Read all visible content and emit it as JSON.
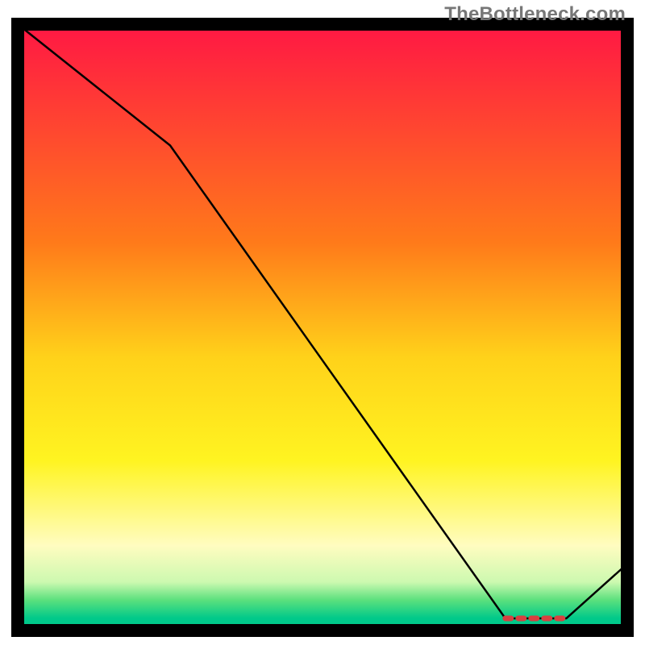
{
  "watermark": "TheBottleneck.com",
  "chart_data": {
    "type": "line",
    "title": "",
    "xlabel": "",
    "ylabel": "",
    "xlim": [
      0,
      100
    ],
    "ylim": [
      0,
      100
    ],
    "x": [
      0,
      25,
      80,
      90,
      100
    ],
    "values": [
      100,
      80,
      2,
      2,
      11
    ],
    "gradient_stops": [
      {
        "offset": 0,
        "color": "#ff1744"
      },
      {
        "offset": 0.36,
        "color": "#ff7a1a"
      },
      {
        "offset": 0.55,
        "color": "#ffd21a"
      },
      {
        "offset": 0.72,
        "color": "#fff421"
      },
      {
        "offset": 0.86,
        "color": "#fffcc0"
      },
      {
        "offset": 0.92,
        "color": "#cdf9b0"
      },
      {
        "offset": 0.95,
        "color": "#5ae07d"
      },
      {
        "offset": 0.98,
        "color": "#00c98a"
      }
    ],
    "frame_color": "#000000",
    "line_color": "#000000",
    "marker": {
      "x_start": 80,
      "x_end": 90,
      "y": 2,
      "color": "#d84040"
    }
  }
}
